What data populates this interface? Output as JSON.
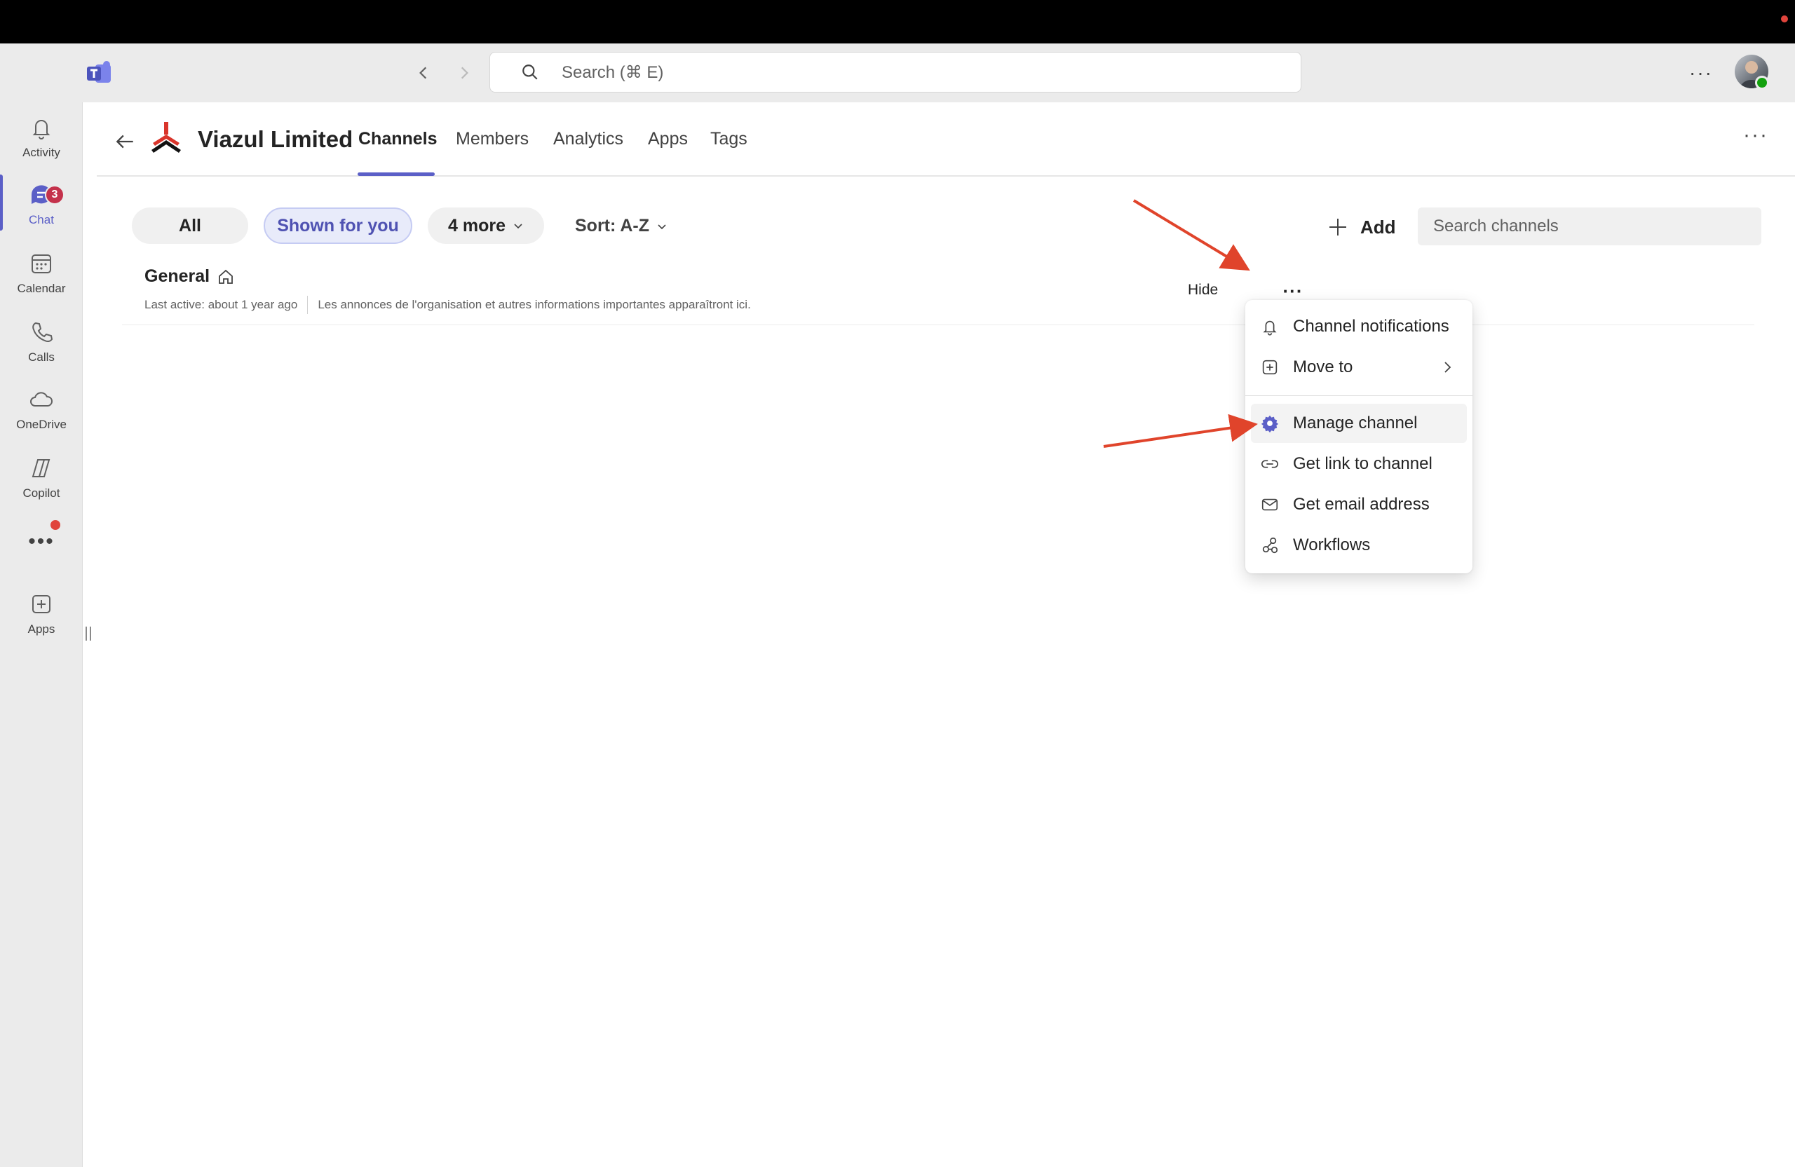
{
  "app": {
    "search_placeholder": "Search (⌘ E)"
  },
  "rail": {
    "items": [
      {
        "label": "Activity",
        "icon": "bell-icon"
      },
      {
        "label": "Chat",
        "icon": "chat-icon",
        "badge": "3"
      },
      {
        "label": "Calendar",
        "icon": "calendar-icon"
      },
      {
        "label": "Calls",
        "icon": "phone-icon"
      },
      {
        "label": "OneDrive",
        "icon": "cloud-icon"
      },
      {
        "label": "Copilot",
        "icon": "copilot-icon"
      },
      {
        "label": "Apps",
        "icon": "add-app-icon"
      }
    ],
    "more": "•••"
  },
  "team": {
    "name": "Viazul Limited",
    "tabs": [
      "Channels",
      "Members",
      "Analytics",
      "Apps",
      "Tags"
    ],
    "active_tab": "Channels"
  },
  "filters": {
    "all": "All",
    "shown_for_you": "Shown for you",
    "more": "4 more",
    "sort": "Sort: A-Z",
    "add": "Add",
    "search_placeholder": "Search channels"
  },
  "channels": [
    {
      "name": "General",
      "last_active": "Last active: about 1 year ago",
      "description": "Les annonces de l'organisation et autres informations importantes apparaîtront ici.",
      "hide_label": "Hide"
    }
  ],
  "context_menu": {
    "items": [
      {
        "label": "Channel notifications",
        "icon": "bell-icon"
      },
      {
        "label": "Move to",
        "icon": "move-icon"
      },
      {
        "label": "Manage channel",
        "icon": "gear-icon"
      },
      {
        "label": "Get link to channel",
        "icon": "link-icon"
      },
      {
        "label": "Get email address",
        "icon": "mail-icon"
      },
      {
        "label": "Workflows",
        "icon": "workflows-icon"
      }
    ]
  },
  "colors": {
    "accent": "#5b5fc7",
    "annotation_arrow": "#e0442b",
    "badge": "#c4314b"
  }
}
